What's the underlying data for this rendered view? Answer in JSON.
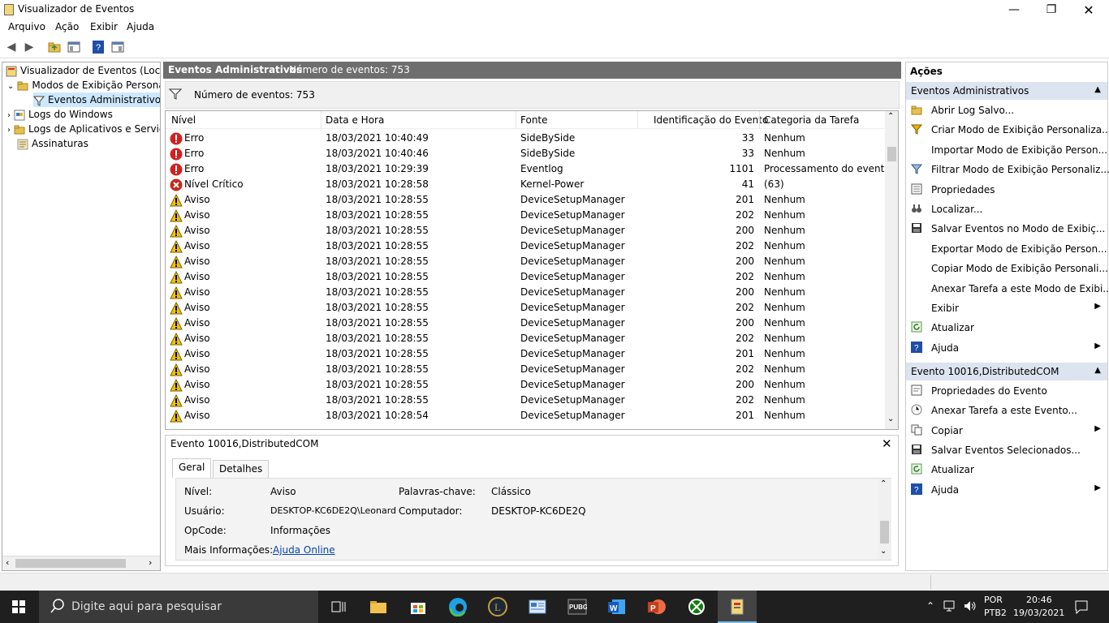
{
  "window": {
    "title": "Visualizador de Eventos"
  },
  "menu": [
    "Arquivo",
    "Ação",
    "Exibir",
    "Ajuda"
  ],
  "tree": {
    "root": "Visualizador de Eventos (Local)",
    "custom_views": "Modos de Exibição Personali",
    "admin_events": "Eventos Administrativos",
    "windows_logs": "Logs do Windows",
    "app_logs": "Logs de Aplicativos e Serviço",
    "subscriptions": "Assinaturas"
  },
  "center": {
    "header_title": "Eventos Administrativos",
    "header_count": "Número de eventos: 753",
    "filter_count": "Número de eventos: 753",
    "columns": [
      "Nível",
      "Data e Hora",
      "Fonte",
      "Identificação do Evento",
      "Categoria da Tarefa"
    ],
    "rows": [
      {
        "type": "error",
        "level": "Erro",
        "date": "18/03/2021 10:40:49",
        "source": "SideBySide",
        "id": "33",
        "cat": "Nenhum"
      },
      {
        "type": "error",
        "level": "Erro",
        "date": "18/03/2021 10:40:46",
        "source": "SideBySide",
        "id": "33",
        "cat": "Nenhum"
      },
      {
        "type": "error",
        "level": "Erro",
        "date": "18/03/2021 10:29:39",
        "source": "Eventlog",
        "id": "1101",
        "cat": "Processamento do evento"
      },
      {
        "type": "critical",
        "level": "Nível Crítico",
        "date": "18/03/2021 10:28:58",
        "source": "Kernel-Power",
        "id": "41",
        "cat": "(63)"
      },
      {
        "type": "warn",
        "level": "Aviso",
        "date": "18/03/2021 10:28:55",
        "source": "DeviceSetupManager",
        "id": "201",
        "cat": "Nenhum"
      },
      {
        "type": "warn",
        "level": "Aviso",
        "date": "18/03/2021 10:28:55",
        "source": "DeviceSetupManager",
        "id": "202",
        "cat": "Nenhum"
      },
      {
        "type": "warn",
        "level": "Aviso",
        "date": "18/03/2021 10:28:55",
        "source": "DeviceSetupManager",
        "id": "200",
        "cat": "Nenhum"
      },
      {
        "type": "warn",
        "level": "Aviso",
        "date": "18/03/2021 10:28:55",
        "source": "DeviceSetupManager",
        "id": "202",
        "cat": "Nenhum"
      },
      {
        "type": "warn",
        "level": "Aviso",
        "date": "18/03/2021 10:28:55",
        "source": "DeviceSetupManager",
        "id": "200",
        "cat": "Nenhum"
      },
      {
        "type": "warn",
        "level": "Aviso",
        "date": "18/03/2021 10:28:55",
        "source": "DeviceSetupManager",
        "id": "202",
        "cat": "Nenhum"
      },
      {
        "type": "warn",
        "level": "Aviso",
        "date": "18/03/2021 10:28:55",
        "source": "DeviceSetupManager",
        "id": "200",
        "cat": "Nenhum"
      },
      {
        "type": "warn",
        "level": "Aviso",
        "date": "18/03/2021 10:28:55",
        "source": "DeviceSetupManager",
        "id": "202",
        "cat": "Nenhum"
      },
      {
        "type": "warn",
        "level": "Aviso",
        "date": "18/03/2021 10:28:55",
        "source": "DeviceSetupManager",
        "id": "200",
        "cat": "Nenhum"
      },
      {
        "type": "warn",
        "level": "Aviso",
        "date": "18/03/2021 10:28:55",
        "source": "DeviceSetupManager",
        "id": "202",
        "cat": "Nenhum"
      },
      {
        "type": "warn",
        "level": "Aviso",
        "date": "18/03/2021 10:28:55",
        "source": "DeviceSetupManager",
        "id": "201",
        "cat": "Nenhum"
      },
      {
        "type": "warn",
        "level": "Aviso",
        "date": "18/03/2021 10:28:55",
        "source": "DeviceSetupManager",
        "id": "202",
        "cat": "Nenhum"
      },
      {
        "type": "warn",
        "level": "Aviso",
        "date": "18/03/2021 10:28:55",
        "source": "DeviceSetupManager",
        "id": "200",
        "cat": "Nenhum"
      },
      {
        "type": "warn",
        "level": "Aviso",
        "date": "18/03/2021 10:28:55",
        "source": "DeviceSetupManager",
        "id": "202",
        "cat": "Nenhum"
      },
      {
        "type": "warn",
        "level": "Aviso",
        "date": "18/03/2021 10:28:54",
        "source": "DeviceSetupManager",
        "id": "201",
        "cat": "Nenhum"
      }
    ]
  },
  "detail": {
    "title": "Evento 10016,DistributedCOM",
    "tabs": [
      "Geral",
      "Detalhes"
    ],
    "fields": {
      "level_label": "Nível:",
      "level_value": "Aviso",
      "keywords_label": "Palavras-chave:",
      "keywords_value": "Clássico",
      "user_label": "Usuário:",
      "user_value": "DESKTOP-KC6DE2Q\\Leonard",
      "computer_label": "Computador:",
      "computer_value": "DESKTOP-KC6DE2Q",
      "opcode_label": "OpCode:",
      "opcode_value": "Informações",
      "more_label": "Mais Informações:",
      "more_link": "Ajuda Online"
    }
  },
  "actions": {
    "title": "Ações",
    "section1": "Eventos Administrativos",
    "items1": [
      {
        "icon": "folder-open-icon",
        "label": "Abrir Log Salvo...",
        "sub": false
      },
      {
        "icon": "filter-add-icon",
        "label": "Criar Modo de Exibição Personaliza...",
        "sub": false
      },
      {
        "icon": "",
        "label": "Importar Modo de Exibição Person...",
        "sub": false
      },
      {
        "icon": "filter-icon",
        "label": "Filtrar Modo de Exibição Personaliz...",
        "sub": false
      },
      {
        "icon": "properties-icon",
        "label": "Propriedades",
        "sub": false
      },
      {
        "icon": "binoculars-icon",
        "label": "Localizar...",
        "sub": false
      },
      {
        "icon": "save-icon",
        "label": "Salvar Eventos no Modo de Exibiç...",
        "sub": false
      },
      {
        "icon": "",
        "label": "Exportar Modo de Exibição Person...",
        "sub": false
      },
      {
        "icon": "",
        "label": "Copiar Modo de Exibição Personali...",
        "sub": false
      },
      {
        "icon": "",
        "label": "Anexar Tarefa a este Modo de Exibi...",
        "sub": false
      },
      {
        "icon": "",
        "label": "Exibir",
        "sub": true
      },
      {
        "icon": "refresh-icon",
        "label": "Atualizar",
        "sub": false
      },
      {
        "icon": "help-icon",
        "label": "Ajuda",
        "sub": true
      }
    ],
    "section2": "Evento 10016,DistributedCOM",
    "items2": [
      {
        "icon": "event-props-icon",
        "label": "Propriedades do Evento",
        "sub": false
      },
      {
        "icon": "attach-task-icon",
        "label": "Anexar Tarefa a este Evento...",
        "sub": false
      },
      {
        "icon": "copy-icon",
        "label": "Copiar",
        "sub": true
      },
      {
        "icon": "save-icon",
        "label": "Salvar Eventos Selecionados...",
        "sub": false
      },
      {
        "icon": "refresh-icon",
        "label": "Atualizar",
        "sub": false
      },
      {
        "icon": "help-icon",
        "label": "Ajuda",
        "sub": true
      }
    ]
  },
  "taskbar": {
    "search_placeholder": "Digite aqui para pesquisar",
    "lang": "POR",
    "layout": "PTB2",
    "time": "20:46",
    "date": "19/03/2021"
  },
  "colors": {
    "accent": "#0078d7",
    "header_gray": "#6e6e6e",
    "section_blue": "#dbe4ef",
    "link": "#0645ad"
  }
}
